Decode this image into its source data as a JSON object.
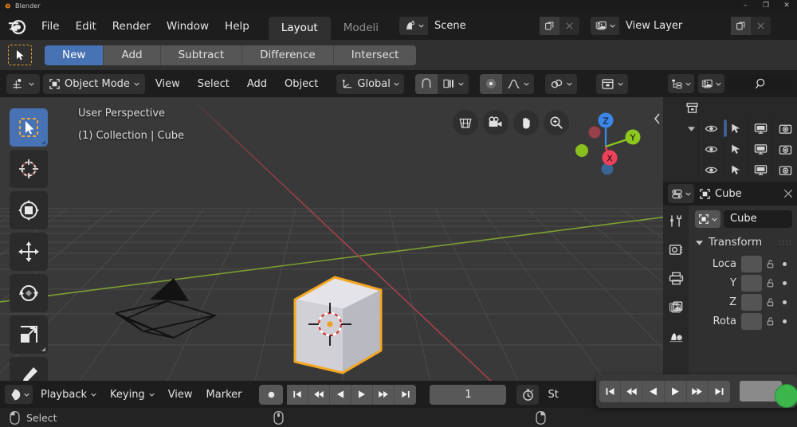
{
  "window": {
    "title": "Blender",
    "app_icon": "blender-logo-icon",
    "minimize": "–",
    "maximize": "❐",
    "close": "✕"
  },
  "topbar": {
    "logo_icon": "blender-logo-icon",
    "menus": [
      {
        "label": "File",
        "name": "menu-file"
      },
      {
        "label": "Edit",
        "name": "menu-edit"
      },
      {
        "label": "Render",
        "name": "menu-render"
      },
      {
        "label": "Window",
        "name": "menu-window"
      },
      {
        "label": "Help",
        "name": "menu-help"
      }
    ],
    "workspace_tabs": [
      {
        "label": "Layout",
        "active": true
      },
      {
        "label": "Modeli",
        "active": false
      }
    ],
    "scene": {
      "icon": "scene-icon",
      "value": "Scene",
      "new_icon": "duplicate-icon",
      "unlink_icon": "x-icon"
    },
    "view_layer": {
      "icon": "view-layer-icon",
      "value": "View Layer",
      "new_icon": "duplicate-icon",
      "unlink_icon": "x-icon"
    }
  },
  "tool_settings": {
    "active_tool_icon": "select-box-icon",
    "modes": [
      {
        "label": "New",
        "active": true
      },
      {
        "label": "Add",
        "active": false
      },
      {
        "label": "Subtract",
        "active": false
      },
      {
        "label": "Difference",
        "active": false
      },
      {
        "label": "Intersect",
        "active": false
      }
    ]
  },
  "viewport_header": {
    "editor_type_icon": "editor-type-3dview-icon",
    "mode": {
      "icon": "object-mode-icon",
      "label": "Object Mode",
      "chevron": "chevron-down-icon"
    },
    "menus": [
      {
        "label": "View",
        "name": "viewport-menu-view"
      },
      {
        "label": "Select",
        "name": "viewport-menu-select"
      },
      {
        "label": "Add",
        "name": "viewport-menu-add"
      },
      {
        "label": "Object",
        "name": "viewport-menu-object"
      }
    ],
    "transform_orientation": {
      "icon": "orientation-axis-icon",
      "label": "Global",
      "chevron": "chevron-down-icon"
    },
    "snap_icon": "magnet-icon",
    "snap_target_icon": "snap-increment-icon",
    "proportional_icon": "proportional-edit-icon",
    "falloff_icon": "smooth-falloff-icon",
    "mirror_icon": "mirror-options-icon",
    "viewport_overlays_icon": "viewport-gizmo-icon"
  },
  "viewport": {
    "perspective_label": "User Perspective",
    "collection_label": "(1) Collection | Cube",
    "nav_icons": [
      {
        "name": "toggle-grid-icon"
      },
      {
        "name": "camera-view-icon"
      },
      {
        "name": "pan-view-icon"
      },
      {
        "name": "zoom-view-icon"
      }
    ],
    "axis_gizmo": {
      "axes": [
        {
          "label": "Z",
          "color": "#3b86e8"
        },
        {
          "label": "Y",
          "color": "#8dc71f"
        },
        {
          "label": "X",
          "color": "#f0415a"
        }
      ],
      "neg_colors": [
        "#a3434f",
        "#7da83f",
        "#3b6a9e"
      ]
    },
    "sidebar_toggle_icon": "chevron-left-icon",
    "toolbar": [
      {
        "name": "tool-select-box",
        "icon": "select-box-icon",
        "active": true
      },
      {
        "name": "tool-cursor",
        "icon": "cursor-3d-icon",
        "active": false
      },
      {
        "name": "tool-transform",
        "icon": "transform-icon",
        "active": false
      },
      {
        "name": "tool-move",
        "icon": "move-icon",
        "active": false
      },
      {
        "name": "tool-rotate",
        "icon": "rotate-icon",
        "active": false
      },
      {
        "name": "tool-scale",
        "icon": "scale-icon",
        "active": false
      },
      {
        "name": "tool-annotate",
        "icon": "annotate-pencil-icon",
        "active": false
      }
    ],
    "objects": [
      {
        "name": "camera-wireframe",
        "type": "camera"
      },
      {
        "name": "cube-mesh",
        "type": "mesh",
        "selected": true
      },
      {
        "name": "cursor-3d",
        "type": "cursor"
      }
    ],
    "grid_colors": {
      "background": "#393939",
      "x_axis": "#a3414f",
      "y_axis": "#7ba031",
      "selected_outline": "#f5a623"
    }
  },
  "outliner": {
    "display_mode_icon": "outliner-display-icon",
    "filter_icon": "outliner-filter-icon",
    "search_icon": "search-icon",
    "collection_icon": "collection-icon",
    "expand_icon": "triangle-down-icon",
    "rows": [
      {
        "name": "outliner-row-collection",
        "restrict": []
      },
      {
        "name": "outliner-row-1",
        "restrict": [
          "eye-icon",
          "cursor-select-icon",
          "monitor-icon",
          "camera-icon"
        ]
      },
      {
        "name": "outliner-row-2",
        "restrict": [
          "eye-icon",
          "cursor-select-icon",
          "monitor-icon",
          "camera-icon"
        ]
      },
      {
        "name": "outliner-row-3",
        "restrict": [
          "eye-icon",
          "cursor-select-icon",
          "monitor-icon",
          "camera-icon"
        ]
      }
    ]
  },
  "properties": {
    "editor_icon": "properties-editor-icon",
    "breadcrumb_object_icon": "object-data-icon",
    "breadcrumb_label": "Cube",
    "pin_icon": "pin-icon",
    "tabs": [
      {
        "name": "prop-tab-tool",
        "icon": "tool-wrench-icon"
      },
      {
        "name": "prop-tab-render",
        "icon": "render-camera-icon"
      },
      {
        "name": "prop-tab-output",
        "icon": "printer-icon"
      },
      {
        "name": "prop-tab-view-layer",
        "icon": "images-icon"
      },
      {
        "name": "prop-tab-scene",
        "icon": "scene-cone-icon"
      }
    ],
    "object_name": {
      "icon": "object-data-icon",
      "chevron": "chevron-down-icon",
      "value": "Cube"
    },
    "transform_panel": {
      "expand_icon": "triangle-down-icon",
      "title": "Transform",
      "grip": "::::",
      "rows": [
        {
          "label": "Loca",
          "lock_icon": "unlock-icon",
          "animate_icon": "animate-dot-icon"
        },
        {
          "label": "Y",
          "lock_icon": "unlock-icon",
          "animate_icon": "animate-dot-icon"
        },
        {
          "label": "Z",
          "lock_icon": "unlock-icon",
          "animate_icon": "animate-dot-icon"
        },
        {
          "label": "Rota",
          "lock_icon": "unlock-icon",
          "animate_icon": "animate-dot-icon"
        }
      ]
    }
  },
  "timeline": {
    "editor_icon": "timeline-editor-icon",
    "menus": [
      {
        "label": "Playback",
        "chevron": true
      },
      {
        "label": "Keying",
        "chevron": true
      },
      {
        "label": "View",
        "chevron": false
      },
      {
        "label": "Marker",
        "chevron": false
      }
    ],
    "record_icon": "record-icon",
    "transport": [
      {
        "name": "jump-to-start-button",
        "icon": "skip-start-icon"
      },
      {
        "name": "previous-keyframe-button",
        "icon": "rewind-icon"
      },
      {
        "name": "play-reverse-button",
        "icon": "play-reverse-icon"
      },
      {
        "name": "play-button",
        "icon": "play-icon"
      },
      {
        "name": "next-keyframe-button",
        "icon": "fast-forward-icon"
      },
      {
        "name": "jump-to-end-button",
        "icon": "skip-end-icon"
      }
    ],
    "current_frame": "1",
    "auto_key_icon": "stopwatch-icon",
    "start_label": "St"
  },
  "floating_overlay": {
    "transport": [
      {
        "name": "overlay-jump-to-start",
        "icon": "skip-start-icon"
      },
      {
        "name": "overlay-previous-keyframe",
        "icon": "rewind-icon"
      },
      {
        "name": "overlay-play-reverse",
        "icon": "play-reverse-icon"
      },
      {
        "name": "overlay-play",
        "icon": "play-icon"
      },
      {
        "name": "overlay-next-keyframe",
        "icon": "fast-forward-icon"
      },
      {
        "name": "overlay-jump-to-end",
        "icon": "skip-end-icon"
      }
    ],
    "badge_color": "#3cb54a"
  },
  "statusbar": {
    "mouse_left_icon": "mouse-left-icon",
    "left_action": "Select",
    "mouse_middle_icon": "mouse-middle-icon",
    "mouse_right_icon": "mouse-right-icon"
  }
}
